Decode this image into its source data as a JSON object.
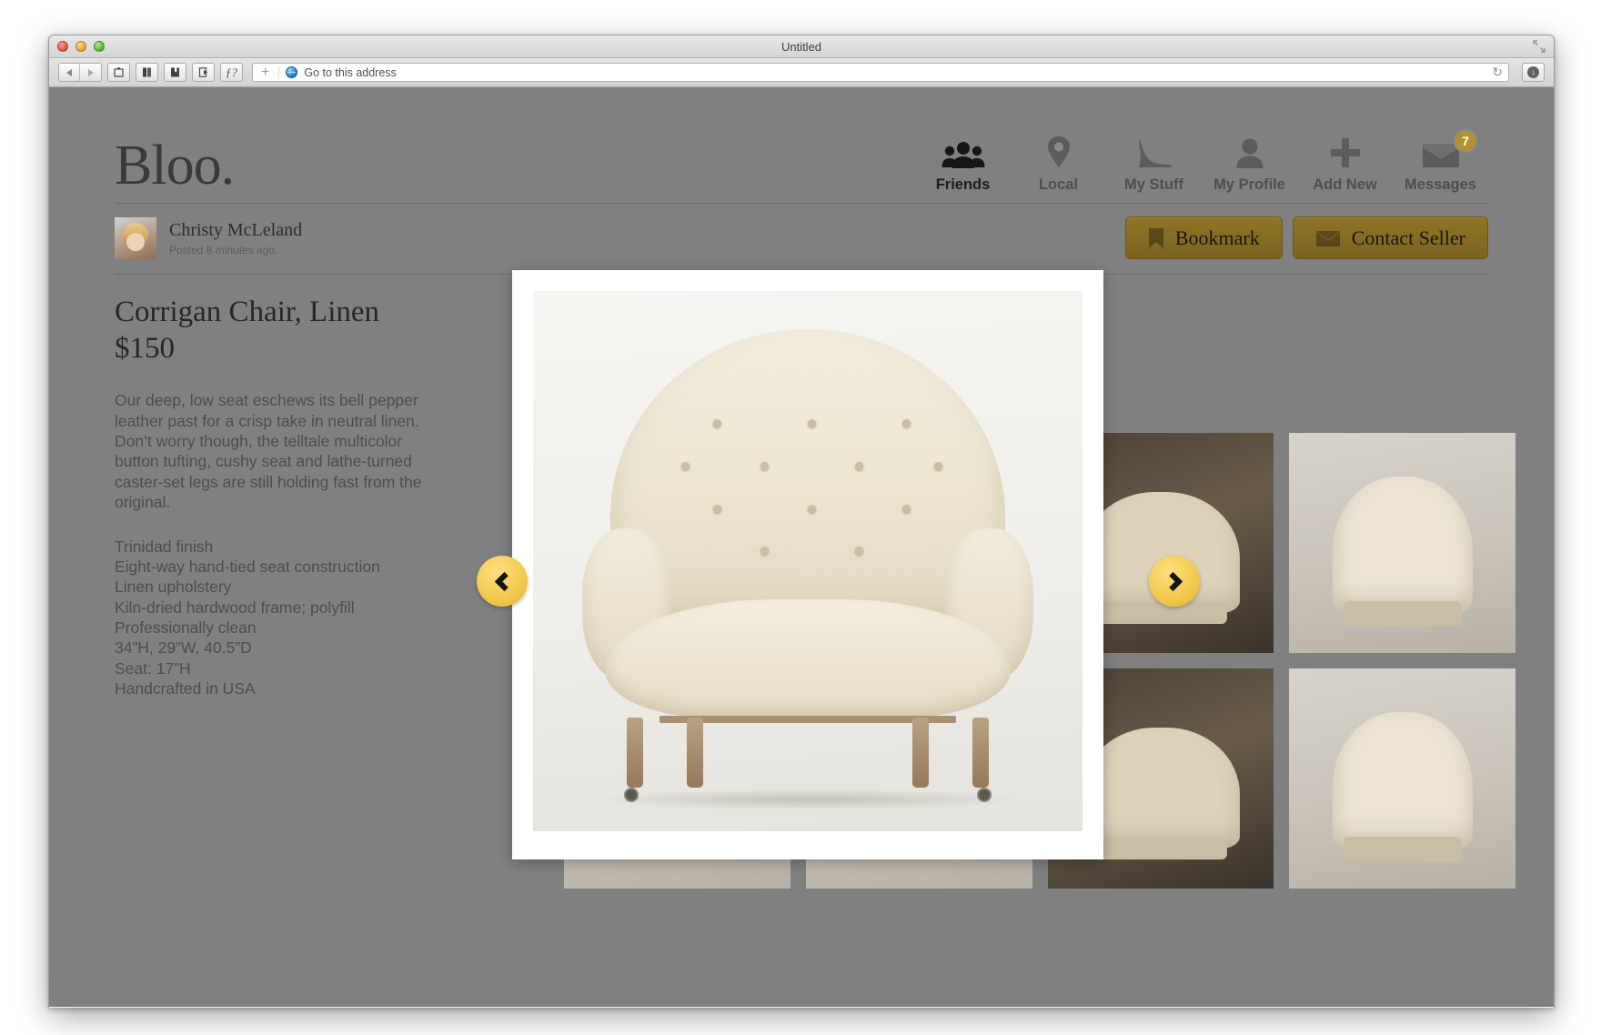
{
  "window": {
    "title": "Untitled",
    "traffic_lights": [
      "close",
      "minimize",
      "maximize"
    ]
  },
  "toolbar": {
    "address_placeholder": "Go to this address",
    "address_value": "Go to this address",
    "plus_label": "+",
    "reload_glyph": "↻",
    "download_glyph": "↓",
    "buttons": [
      {
        "name": "back-forward",
        "label": ""
      },
      {
        "name": "snapshot",
        "label": ""
      },
      {
        "name": "library",
        "label": ""
      },
      {
        "name": "bookmarks",
        "label": ""
      },
      {
        "name": "share",
        "label": ""
      },
      {
        "name": "font-size",
        "label": "ƒ?"
      }
    ]
  },
  "site": {
    "logo": "Bloo.",
    "nav": [
      {
        "label": "Friends",
        "icon": "people-icon",
        "active": true,
        "badge": ""
      },
      {
        "label": "Local",
        "icon": "map-pin-icon",
        "active": false,
        "badge": ""
      },
      {
        "label": "My Stuff",
        "icon": "high-heel-icon",
        "active": false,
        "badge": ""
      },
      {
        "label": "My Profile",
        "icon": "person-icon",
        "active": false,
        "badge": ""
      },
      {
        "label": "Add New",
        "icon": "plus-icon",
        "active": false,
        "badge": ""
      },
      {
        "label": "Messages",
        "icon": "envelope-icon",
        "active": false,
        "badge": "7"
      }
    ]
  },
  "seller": {
    "name": "Christy McLeland",
    "posted": "Posted 8 minutes ago.",
    "avatar_alt": "Christy McLeland avatar"
  },
  "actions": {
    "bookmark_label": "Bookmark",
    "contact_label": "Contact Seller"
  },
  "product": {
    "title": "Corrigan Chair, Linen",
    "price": "$150",
    "description": "Our deep, low seat eschews its bell pepper leather past for a crisp take in neutral linen. Don’t worry though, the telltale multicolor button tufting, cushy seat and lathe-turned caster-set legs are still holding fast from the original.",
    "specs": [
      "Trinidad finish",
      "Eight-way hand-tied seat construction",
      "Linen upholstery",
      "Kiln-dried hardwood frame; polyfill",
      "Professionally clean",
      "34”H, 29”W, 40.5”D",
      "Seat: 17”H",
      "Handcrafted in USA"
    ]
  },
  "carousel": {
    "prev_label": "‹",
    "next_label": "›"
  },
  "gallery": {
    "thumbnails": [
      {
        "kind": "room",
        "alt": "Chair in styled room"
      },
      {
        "kind": "plain",
        "alt": "Chair front view on white"
      },
      {
        "kind": "room",
        "alt": "Chair beside table in room"
      },
      {
        "kind": "plain",
        "alt": "Chair angled view on white"
      },
      {
        "kind": "plain",
        "alt": "Chair front view on white"
      },
      {
        "kind": "plain",
        "alt": "Chair back view on white"
      },
      {
        "kind": "room",
        "alt": "Chair in living room setting"
      },
      {
        "kind": "plain",
        "alt": "Chair three-quarter view on white"
      }
    ]
  },
  "lightbox": {
    "alt": "Corrigan Chair, Linen — large product photo"
  },
  "colors": {
    "accent_gold": "#b5922e",
    "button_gold": "#8e7526",
    "arrow_yellow": "#efc445",
    "page_overlay": "#808080",
    "text_dark": "#262626"
  }
}
